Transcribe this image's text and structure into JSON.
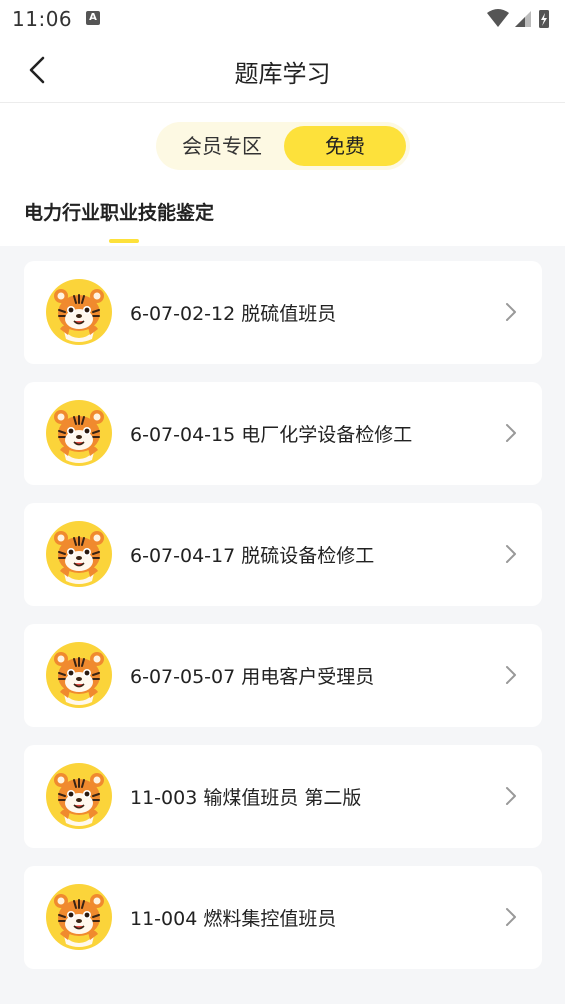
{
  "status_bar": {
    "time": "11:06",
    "notification_badge": "A"
  },
  "header": {
    "title": "题库学习"
  },
  "segment": {
    "members_label": "会员专区",
    "free_label": "免费"
  },
  "section": {
    "title": "电力行业职业技能鉴定"
  },
  "accent_color": "#fde13b",
  "courses": [
    {
      "label": "6-07-02-12 脱硫值班员"
    },
    {
      "label": "6-07-04-15 电厂化学设备检修工"
    },
    {
      "label": "6-07-04-17 脱硫设备检修工"
    },
    {
      "label": "6-07-05-07 用电客户受理员"
    },
    {
      "label": "11-003 输煤值班员 第二版"
    },
    {
      "label": "11-004 燃料集控值班员"
    }
  ]
}
